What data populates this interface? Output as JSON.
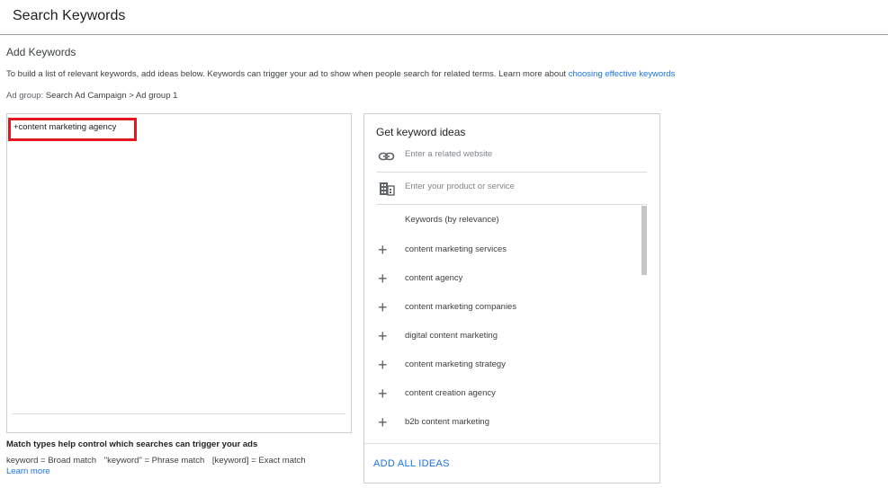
{
  "header": {
    "title": "Search Keywords"
  },
  "section": {
    "title": "Add Keywords",
    "description": "To build a list of relevant keywords, add ideas below. Keywords can trigger your ad to show when people search for related terms. Learn more about ",
    "description_link": "choosing effective keywords",
    "ad_group_label": "Ad group: ",
    "ad_group_value": "Search Ad Campaign > Ad group 1"
  },
  "editor": {
    "keyword_text": "+content marketing agency"
  },
  "match_types": {
    "title": "Match types help control which searches can trigger your ads",
    "broad": "keyword = Broad match",
    "phrase": "\"keyword\" = Phrase match",
    "exact": "[keyword] = Exact match",
    "learn_more": "Learn more"
  },
  "ideas_panel": {
    "title": "Get keyword ideas",
    "website_placeholder": "Enter a related website",
    "product_placeholder": "Enter your product or service",
    "list_header": "Keywords (by relevance)",
    "keywords": [
      "content marketing services",
      "content agency",
      "content marketing companies",
      "digital content marketing",
      "content marketing strategy",
      "content creation agency",
      "b2b content marketing"
    ],
    "add_all_label": "ADD ALL IDEAS"
  }
}
